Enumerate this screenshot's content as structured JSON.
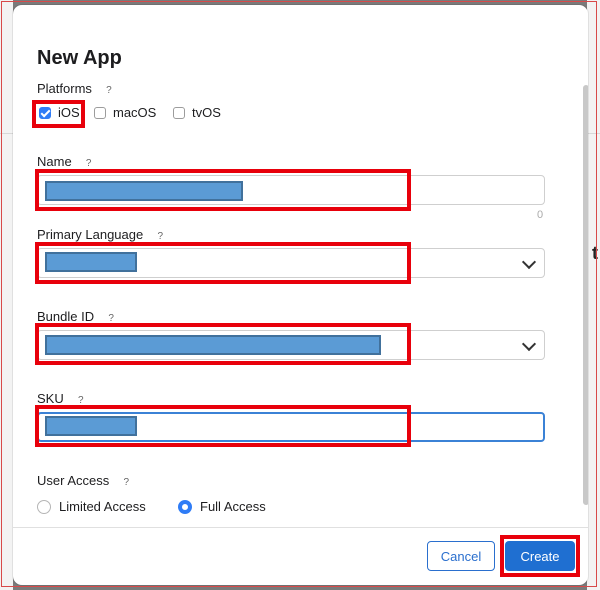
{
  "dialog": {
    "title": "New App",
    "platforms": {
      "label": "Platforms",
      "help": "?",
      "options": [
        {
          "label": "iOS",
          "checked": true
        },
        {
          "label": "macOS",
          "checked": false
        },
        {
          "label": "tvOS",
          "checked": false
        }
      ]
    },
    "name": {
      "label": "Name",
      "help": "?",
      "counter": "0"
    },
    "primary_language": {
      "label": "Primary Language",
      "help": "?"
    },
    "bundle_id": {
      "label": "Bundle ID",
      "help": "?"
    },
    "sku": {
      "label": "SKU",
      "help": "?"
    },
    "user_access": {
      "label": "User Access",
      "help": "?",
      "options": [
        {
          "label": "Limited Access",
          "selected": false
        },
        {
          "label": "Full Access",
          "selected": true
        }
      ]
    },
    "buttons": {
      "cancel": "Cancel",
      "create": "Create"
    }
  },
  "colors": {
    "accent": "#1f6fd1",
    "highlight": "#e8000b",
    "redaction": "#5b9bd5"
  },
  "background": {
    "partial_text": "t"
  }
}
